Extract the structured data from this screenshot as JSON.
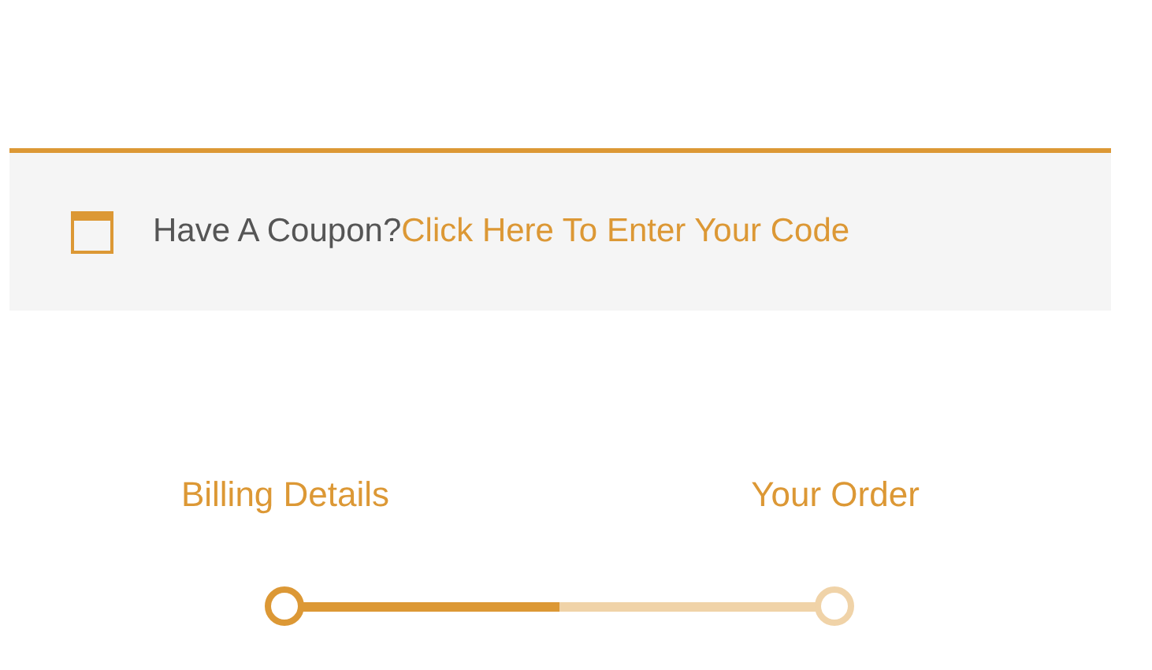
{
  "coupon": {
    "prompt": "Have A Coupon?",
    "link": "Click Here To Enter Your Code"
  },
  "steps": [
    {
      "label": "Billing Details",
      "active": true
    },
    {
      "label": "Your Order",
      "active": false
    }
  ],
  "progress": {
    "level": 0.5
  }
}
